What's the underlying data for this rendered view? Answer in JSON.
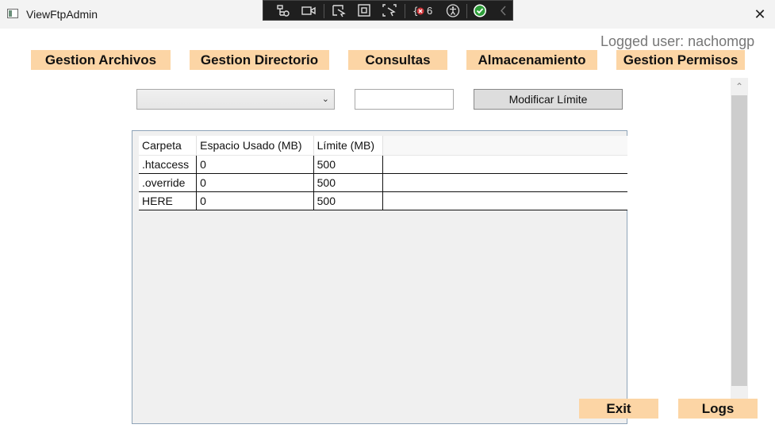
{
  "window": {
    "title": "ViewFtpAdmin",
    "close_symbol": "✕"
  },
  "devtools": {
    "error_count": "6"
  },
  "header": {
    "logged_user": "Logged user: nachomgp"
  },
  "nav": {
    "gestion_archivos": "Gestion Archivos",
    "gestion_directorio": "Gestion Directorio",
    "consultas": "Consultas",
    "almacenamiento": "Almacenamiento",
    "gestion_permisos": "Gestion Permisos"
  },
  "form": {
    "combo_value": "",
    "limit_value": "",
    "modify_label": "Modificar Límite"
  },
  "table": {
    "headers": [
      "Carpeta",
      "Espacio Usado (MB)",
      "Límite (MB)"
    ],
    "rows": [
      {
        "carpeta": ".htaccess",
        "espacio": "0",
        "limite": "500"
      },
      {
        "carpeta": ".override",
        "espacio": "0",
        "limite": "500"
      },
      {
        "carpeta": "HERE",
        "espacio": "0",
        "limite": "500"
      }
    ]
  },
  "footer": {
    "exit_label": "Exit",
    "logs_label": "Logs"
  },
  "colors": {
    "accent_button": "#fcd5a5",
    "titlebar": "#f3f3f3",
    "devbar": "#1f1f1f"
  },
  "icons": [
    "app-icon",
    "live-visual-tree-icon",
    "record-icon",
    "select-element-icon",
    "display-layout-icon",
    "track-focus-icon",
    "binding-failures-icon",
    "accessibility-icon",
    "checkmark-icon",
    "collapse-chevron-icon",
    "close-icon",
    "chevron-down-icon",
    "scroll-up-icon"
  ]
}
